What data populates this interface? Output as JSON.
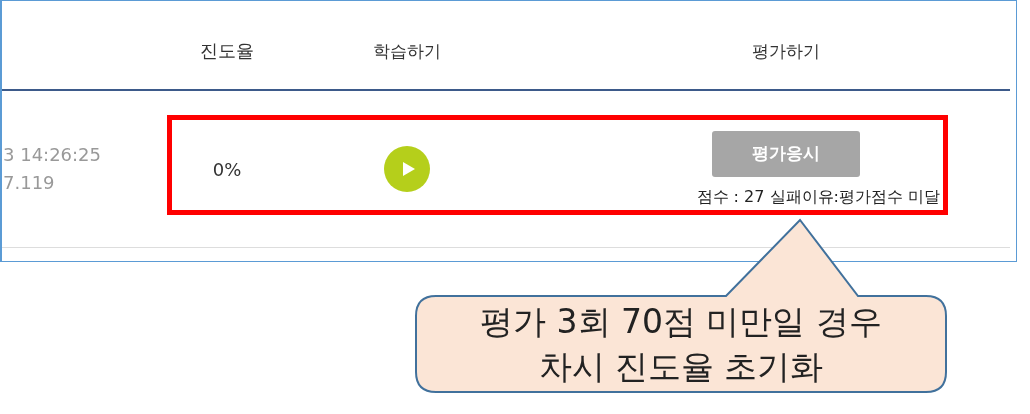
{
  "table": {
    "columns": [
      {
        "label": "진도율"
      },
      {
        "label": "학습하기"
      },
      {
        "label": "평가하기"
      }
    ],
    "rows": [
      {
        "column_1": [
          "3 14:26:25",
          "7.119"
        ],
        "progress": "0%",
        "study": {
          "kind": "play"
        },
        "evaluation": {
          "button": {
            "label": "평가응시",
            "disabled": true
          },
          "result": "점수 : 27 실패이유:평가점수 미달"
        }
      }
    ]
  },
  "callout": {
    "lines": [
      "평가 3회 70점 미만일 경우",
      "차시 진도율 초기화"
    ]
  }
}
